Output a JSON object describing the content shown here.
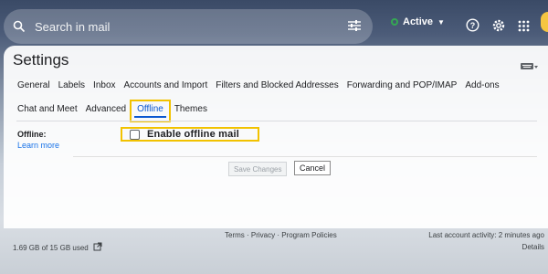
{
  "header": {
    "search_placeholder": "Search in mail",
    "status_label": "Active",
    "icons": [
      "search-icon",
      "tune-icon",
      "chevron-down-icon",
      "help-icon",
      "gear-icon",
      "apps-icon"
    ],
    "status_color": "#34a853"
  },
  "settings": {
    "title": "Settings",
    "tabs_row1": [
      {
        "label": "General"
      },
      {
        "label": "Labels"
      },
      {
        "label": "Inbox"
      },
      {
        "label": "Accounts and Import"
      },
      {
        "label": "Filters and Blocked Addresses"
      },
      {
        "label": "Forwarding and POP/IMAP"
      },
      {
        "label": "Add-ons"
      }
    ],
    "tabs_row2": [
      {
        "label": "Chat and Meet"
      },
      {
        "label": "Advanced"
      },
      {
        "label": "Offline",
        "active": true
      },
      {
        "label": "Themes"
      }
    ],
    "offline_label": "Offline:",
    "learn_more": "Learn more",
    "enable_offline": "Enable offline mail",
    "enable_offline_checked": false,
    "save_label": "Save Changes",
    "cancel_label": "Cancel",
    "accent_color": "#0b57d0",
    "highlight_color": "#f2c200"
  },
  "footer": {
    "storage": "1.69 GB of 15 GB used",
    "links": "Terms · Privacy · Program Policies",
    "last_activity": "Last account activity: 2 minutes ago",
    "details": "Details"
  }
}
